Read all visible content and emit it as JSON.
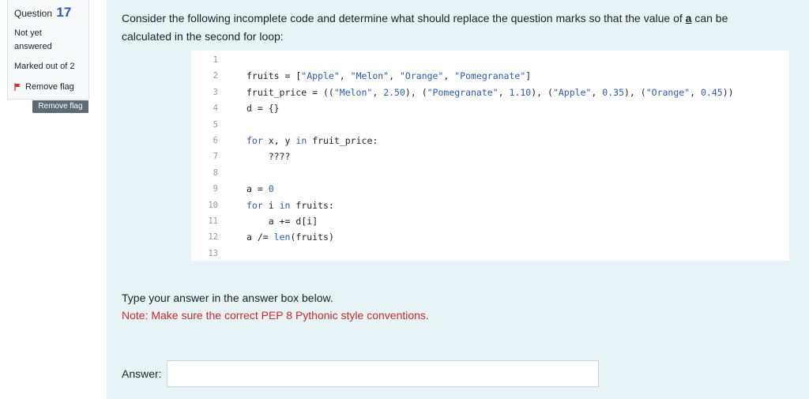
{
  "question": {
    "label": "Question",
    "number": "17",
    "state_line1": "Not yet",
    "state_line2": "answered",
    "grade": "Marked out of 2",
    "flag_label": "Remove flag",
    "flag_button": "Remove flag"
  },
  "prompt": {
    "part1": "Consider the following incomplete code and determine what should replace the question marks so that the value of ",
    "var": "a",
    "part2": " can be calculated in the second for loop:"
  },
  "code": {
    "line_numbers": [
      "1",
      "2",
      "3",
      "4",
      "5",
      "6",
      "7",
      "8",
      "9",
      "10",
      "11",
      "12",
      "13"
    ],
    "lines": [
      "",
      "fruits = [\"Apple\", \"Melon\", \"Orange\", \"Pomegranate\"]",
      "fruit_price = ((\"Melon\", 2.50), (\"Pomegranate\", 1.10), (\"Apple\", 0.35), (\"Orange\", 0.45))",
      "d = {}",
      "",
      "for x, y in fruit_price:",
      "    ????",
      "",
      "a = 0",
      "for i in fruits:",
      "    a += d[i]",
      "a /= len(fruits)",
      ""
    ]
  },
  "instructions": "Type your answer in the answer box below.",
  "note": "Note: Make sure the correct PEP 8 Pythonic style conventions.",
  "answer": {
    "label": "Answer:",
    "value": ""
  },
  "colors": {
    "content_bg": "#e7f3f5",
    "keyword": "#2a5ab8",
    "note": "#c52c2c",
    "flag": "#c0392b",
    "flag_button": "#5e6a74"
  }
}
